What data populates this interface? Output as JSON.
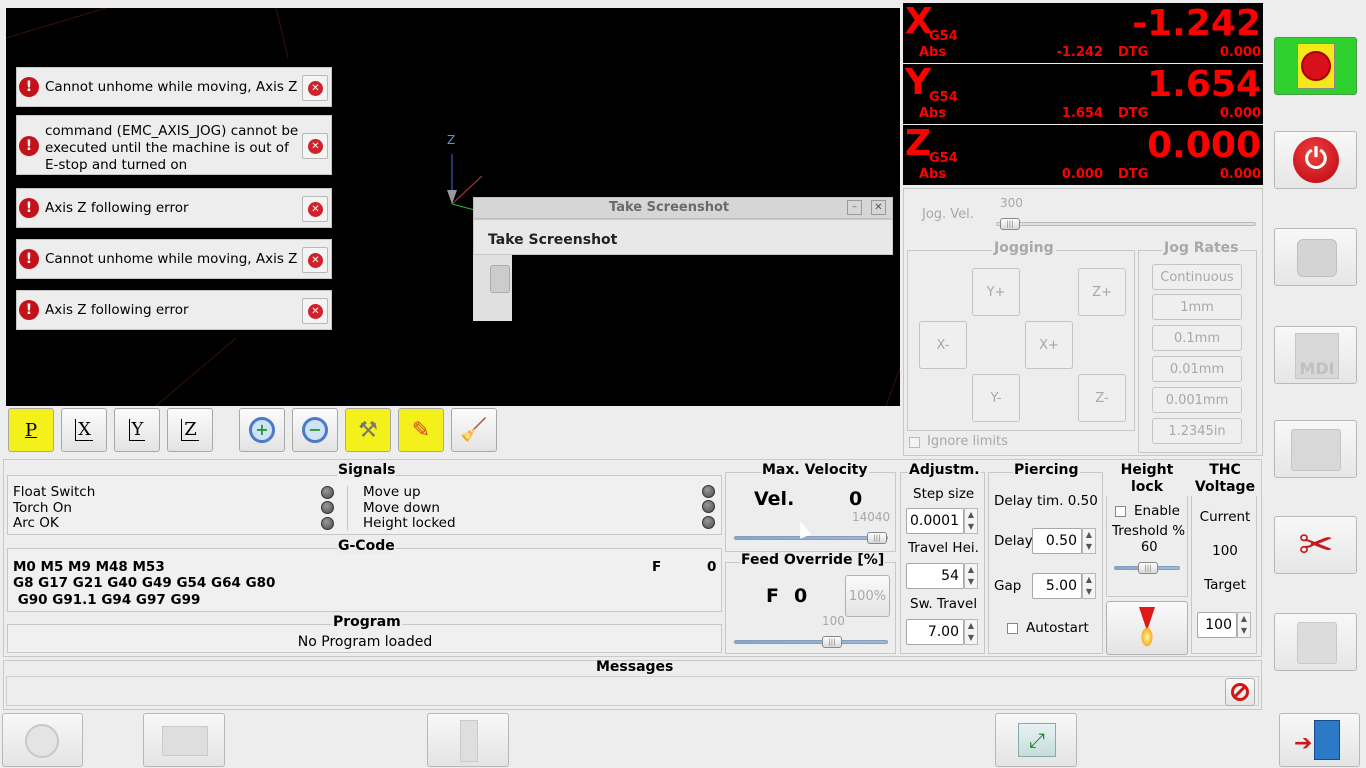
{
  "notifications": [
    {
      "text": "Cannot unhome while moving, Axis Z"
    },
    {
      "text": "command (EMC_AXIS_JOG) cannot be executed until the machine is out of E-stop and turned on"
    },
    {
      "text": "Axis Z following error"
    },
    {
      "text": "Cannot unhome while moving, Axis Z"
    },
    {
      "text": "Axis Z following error"
    }
  ],
  "screenshot_dialog": {
    "title": "Take Screenshot",
    "heading": "Take Screenshot"
  },
  "preview": {
    "axis_label": "Z"
  },
  "toolbar": {
    "p": "P",
    "x": "X",
    "y": "Y",
    "z": "Z"
  },
  "dro": [
    {
      "axis": "X",
      "coord": "G54",
      "value": "-1.242",
      "abs_label": "Abs",
      "abs": "-1.242",
      "dtg_label": "DTG",
      "dtg": "0.000"
    },
    {
      "axis": "Y",
      "coord": "G54",
      "value": "1.654",
      "abs_label": "Abs",
      "abs": "1.654",
      "dtg_label": "DTG",
      "dtg": "0.000"
    },
    {
      "axis": "Z",
      "coord": "G54",
      "value": "0.000",
      "abs_label": "Abs",
      "abs": "0.000",
      "dtg_label": "DTG",
      "dtg": "0.000"
    }
  ],
  "jog": {
    "vel_label": "Jog. Vel.",
    "vel_value": "300",
    "jogging_title": "Jogging",
    "rates_title": "Jog Rates",
    "yplus": "Y+",
    "zplus": "Z+",
    "xminus": "X-",
    "xplus": "X+",
    "yminus": "Y-",
    "zminus": "Z-",
    "rates": [
      "Continuous",
      "1mm",
      "0.1mm",
      "0.01mm",
      "0.001mm",
      "1.2345in"
    ],
    "ignore_limits": "Ignore limits"
  },
  "signals": {
    "title": "Signals",
    "left": [
      "Float Switch",
      "Torch On",
      "Arc OK"
    ],
    "right": [
      "Move up",
      "Move down",
      "Height locked"
    ]
  },
  "gcode": {
    "title": "G-Code",
    "line1": "M0 M5 M9 M48 M53",
    "line2": "G8 G17 G21 G40 G49 G54 G64 G80",
    "line3": " G90 G91.1 G94 G97 G99",
    "f_label": "F",
    "f_value": "0"
  },
  "program": {
    "title": "Program",
    "status": "No Program loaded"
  },
  "max_velocity": {
    "title": "Max. Velocity",
    "label": "Vel.",
    "value": "0",
    "max": "14040"
  },
  "feed_override": {
    "title": "Feed Override [%]",
    "label": "F",
    "value": "0",
    "reset": "100%",
    "slider_value": "100"
  },
  "adjust": {
    "title": "Adjustm.",
    "step_label": "Step size",
    "step": "0.0001",
    "travel_label": "Travel Hei.",
    "travel": "54",
    "sw_label": "Sw. Travel",
    "sw": "7.00"
  },
  "piercing": {
    "title": "Piercing",
    "delay_tim": "Delay tim. 0.50",
    "delay_label": "Delay",
    "delay": "0.50",
    "gap_label": "Gap",
    "gap": "5.00",
    "autostart": "Autostart"
  },
  "height_lock": {
    "title1": "Height",
    "title2": "lock",
    "enable": "Enable",
    "treshold": "Treshold %",
    "treshold_value": "60"
  },
  "thc": {
    "title1": "THC",
    "title2": "Voltage",
    "current_label": "Current",
    "current": "100",
    "target_label": "Target",
    "target": "100"
  },
  "messages": {
    "title": "Messages"
  },
  "colors": {
    "dro_text": "#ff0000",
    "estop_bg": "#2fd12f",
    "power": "#d8101c"
  }
}
